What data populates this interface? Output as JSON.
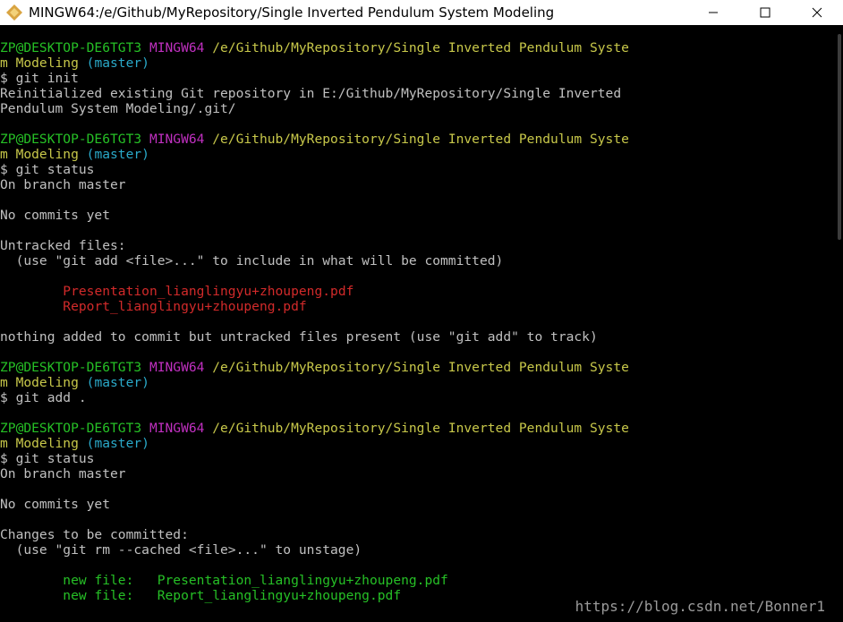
{
  "window": {
    "title": "MINGW64:/e/Github/MyRepository/Single Inverted Pendulum System Modeling",
    "icon": "git-bash-diamond-icon",
    "controls": [
      {
        "name": "minimize-button",
        "glyph": "—"
      },
      {
        "name": "maximize-button",
        "glyph": "☐"
      },
      {
        "name": "close-button",
        "glyph": "✕"
      }
    ]
  },
  "colors": {
    "background": "#000000",
    "text": "#c0c0c0",
    "user_host": "#26c026",
    "mingw": "#c030c0",
    "path": "#c8c84a",
    "branch": "#2aa9c9",
    "untracked": "#d22a2a",
    "staged": "#26c026"
  },
  "terminal": {
    "lines": [
      [
        {
          "t": "ZP@DESKTOP-DE6TGT3 ",
          "c": "user_host"
        },
        {
          "t": "MINGW64 ",
          "c": "mingw"
        },
        {
          "t": "/e/Github/MyRepository/Single Inverted Pendulum Syste",
          "c": "path"
        }
      ],
      [
        {
          "t": "m Modeling ",
          "c": "path"
        },
        {
          "t": "(master)",
          "c": "branch"
        }
      ],
      [
        {
          "t": "$ git init",
          "c": "text"
        }
      ],
      [
        {
          "t": "Reinitialized existing Git repository in E:/Github/MyRepository/Single Inverted",
          "c": "text"
        }
      ],
      [
        {
          "t": "Pendulum System Modeling/.git/",
          "c": "text"
        }
      ],
      [],
      [
        {
          "t": "ZP@DESKTOP-DE6TGT3 ",
          "c": "user_host"
        },
        {
          "t": "MINGW64 ",
          "c": "mingw"
        },
        {
          "t": "/e/Github/MyRepository/Single Inverted Pendulum Syste",
          "c": "path"
        }
      ],
      [
        {
          "t": "m Modeling ",
          "c": "path"
        },
        {
          "t": "(master)",
          "c": "branch"
        }
      ],
      [
        {
          "t": "$ git status",
          "c": "text"
        }
      ],
      [
        {
          "t": "On branch master",
          "c": "text"
        }
      ],
      [],
      [
        {
          "t": "No commits yet",
          "c": "text"
        }
      ],
      [],
      [
        {
          "t": "Untracked files:",
          "c": "text"
        }
      ],
      [
        {
          "t": "  (use \"git add <file>...\" to include in what will be committed)",
          "c": "text"
        }
      ],
      [],
      [
        {
          "t": "        ",
          "c": "text"
        },
        {
          "t": "Presentation_lianglingyu+zhoupeng.pdf",
          "c": "untracked"
        }
      ],
      [
        {
          "t": "        ",
          "c": "text"
        },
        {
          "t": "Report_lianglingyu+zhoupeng.pdf",
          "c": "untracked"
        }
      ],
      [],
      [
        {
          "t": "nothing added to commit but untracked files present (use \"git add\" to track)",
          "c": "text"
        }
      ],
      [],
      [
        {
          "t": "ZP@DESKTOP-DE6TGT3 ",
          "c": "user_host"
        },
        {
          "t": "MINGW64 ",
          "c": "mingw"
        },
        {
          "t": "/e/Github/MyRepository/Single Inverted Pendulum Syste",
          "c": "path"
        }
      ],
      [
        {
          "t": "m Modeling ",
          "c": "path"
        },
        {
          "t": "(master)",
          "c": "branch"
        }
      ],
      [
        {
          "t": "$ git add .",
          "c": "text"
        }
      ],
      [],
      [
        {
          "t": "ZP@DESKTOP-DE6TGT3 ",
          "c": "user_host"
        },
        {
          "t": "MINGW64 ",
          "c": "mingw"
        },
        {
          "t": "/e/Github/MyRepository/Single Inverted Pendulum Syste",
          "c": "path"
        }
      ],
      [
        {
          "t": "m Modeling ",
          "c": "path"
        },
        {
          "t": "(master)",
          "c": "branch"
        }
      ],
      [
        {
          "t": "$ git status",
          "c": "text"
        }
      ],
      [
        {
          "t": "On branch master",
          "c": "text"
        }
      ],
      [],
      [
        {
          "t": "No commits yet",
          "c": "text"
        }
      ],
      [],
      [
        {
          "t": "Changes to be committed:",
          "c": "text"
        }
      ],
      [
        {
          "t": "  (use \"git rm --cached <file>...\" to unstage)",
          "c": "text"
        }
      ],
      [],
      [
        {
          "t": "        ",
          "c": "text"
        },
        {
          "t": "new file:   Presentation_lianglingyu+zhoupeng.pdf",
          "c": "staged"
        }
      ],
      [
        {
          "t": "        ",
          "c": "text"
        },
        {
          "t": "new file:   Report_lianglingyu+zhoupeng.pdf",
          "c": "staged"
        }
      ]
    ]
  },
  "watermark": "https://blog.csdn.net/Bonner1"
}
